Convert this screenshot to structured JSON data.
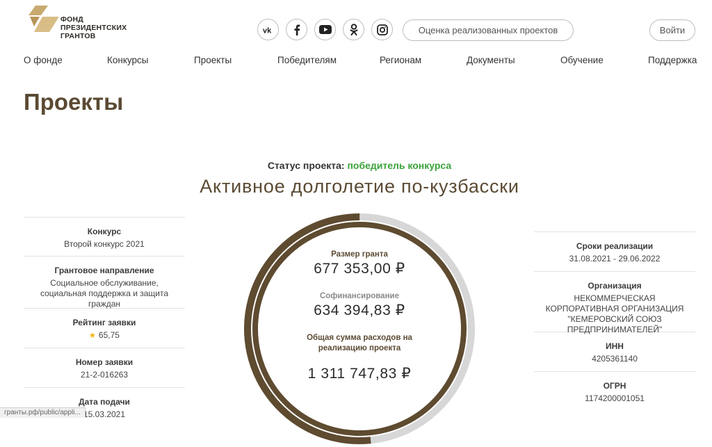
{
  "brand": {
    "name_lines": [
      "ФОНД",
      "ПРЕЗИДЕНТСКИХ",
      "ГРАНТОВ"
    ],
    "logo_color": "#c8a96e"
  },
  "social": [
    {
      "name": "vk-icon"
    },
    {
      "name": "facebook-icon"
    },
    {
      "name": "youtube-icon"
    },
    {
      "name": "odnoklassniki-icon"
    },
    {
      "name": "instagram-icon"
    }
  ],
  "header": {
    "search_label": "Оценка реализованных проектов",
    "login_label": "Войти"
  },
  "nav": {
    "items": [
      {
        "label": "О фонде"
      },
      {
        "label": "Конкурсы"
      },
      {
        "label": "Проекты"
      },
      {
        "label": "Победителям"
      },
      {
        "label": "Регионам"
      },
      {
        "label": "Документы"
      },
      {
        "label": "Обучение"
      },
      {
        "label": "Поддержка"
      }
    ]
  },
  "page": {
    "title": "Проекты",
    "status_label": "Статус проекта:",
    "status_value": "победитель конкурса",
    "project_title": "Активное долголетие по-кузбасски"
  },
  "left_info": [
    {
      "label": "Конкурс",
      "value": "Второй конкурс 2021"
    },
    {
      "label": "Грантовое направление",
      "value": "Социальное обслуживание, социальная поддержка и защита граждан"
    },
    {
      "label": "Рейтинг заявки",
      "value": "65,75"
    },
    {
      "label": "Номер заявки",
      "value": "21-2-016263"
    },
    {
      "label": "Дата подачи",
      "value": "15.03.2021"
    }
  ],
  "right_info": [
    {
      "label": "Сроки реализации",
      "value": "31.08.2021 - 29.06.2022"
    },
    {
      "label": "Организация",
      "value": "НЕКОММЕРЧЕСКАЯ КОРПОРАТИВНАЯ ОРГАНИЗАЦИЯ \"КЕМЕРОВСКИЙ СОЮЗ ПРЕДПРИНИМАТЕЛЕЙ\""
    },
    {
      "label": "ИНН",
      "value": "4205361140"
    },
    {
      "label": "ОГРН",
      "value": "1174200001051"
    }
  ],
  "finance": {
    "grant_label": "Размер гранта",
    "grant_value": "677 353,00 ₽",
    "cofin_label": "Софинансирование",
    "cofin_value": "634 394,83 ₽",
    "total_label": "Общая сумма расходов на реализацию проекта",
    "total_value": "1 311 747,83 ₽",
    "grant_share": 0.516
  },
  "colors": {
    "ring_brown": "#5e4b30",
    "ring_grey": "#d7d7d7",
    "title_brown": "#5b4a33",
    "status_green": "#3aa23a"
  },
  "statusbar": {
    "url": "гранты.рф/public/appli..."
  }
}
